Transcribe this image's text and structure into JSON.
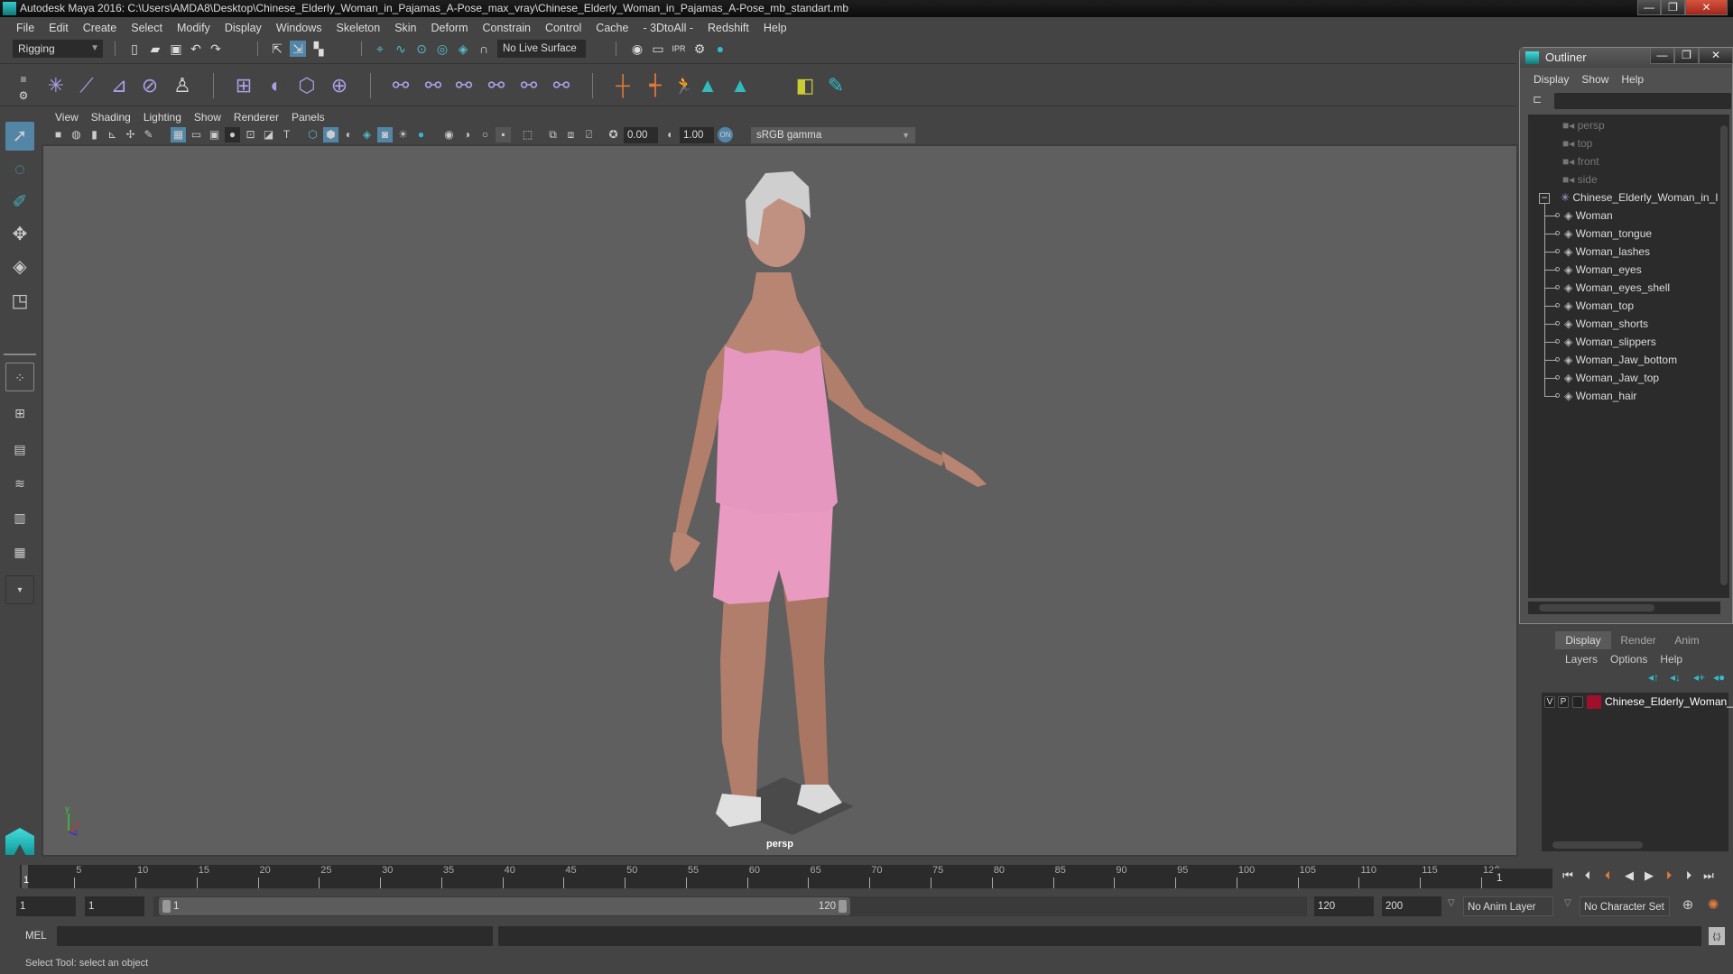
{
  "window": {
    "title": "Autodesk Maya 2016: C:\\Users\\AMDA8\\Desktop\\Chinese_Elderly_Woman_in_Pajamas_A-Pose_max_vray\\Chinese_Elderly_Woman_in_Pajamas_A-Pose_mb_standart.mb",
    "minimize": "—",
    "maximize": "❐",
    "close": "✕"
  },
  "menubar": [
    "File",
    "Edit",
    "Create",
    "Select",
    "Modify",
    "Display",
    "Windows",
    "Skeleton",
    "Skin",
    "Deform",
    "Constrain",
    "Control",
    "Cache",
    "- 3DtoAll -",
    "Redshift",
    "Help"
  ],
  "statusline": {
    "menuset": "Rigging",
    "live_surface": "No Live Surface"
  },
  "panel": {
    "menu": [
      "View",
      "Shading",
      "Lighting",
      "Show",
      "Renderer",
      "Panels"
    ],
    "exposure": "0.00",
    "gamma": "1.00",
    "color_space": "sRGB gamma",
    "camera_label": "persp"
  },
  "timeline": {
    "start": 1,
    "end": 120,
    "ticks": [
      5,
      10,
      15,
      20,
      25,
      30,
      35,
      40,
      45,
      50,
      55,
      60,
      65,
      70,
      75,
      80,
      85,
      90,
      95,
      100,
      105,
      110,
      115,
      120
    ],
    "current_frame_label": "1",
    "current_frame_field": "1"
  },
  "range": {
    "anim_start": "1",
    "playback_start": "1",
    "slider_start_label": "1",
    "slider_end_label": "120",
    "playback_end": "120",
    "anim_end": "200",
    "anim_layer": "No Anim Layer",
    "character_set": "No Character Set"
  },
  "cmdline": {
    "label": "MEL"
  },
  "helpline": {
    "text": "Select Tool: select an object"
  },
  "outliner": {
    "title": "Outliner",
    "menu": [
      "Display",
      "Show",
      "Help"
    ],
    "cameras": [
      "persp",
      "top",
      "front",
      "side"
    ],
    "group": "Chinese_Elderly_Woman_in_I",
    "children": [
      "Woman",
      "Woman_tongue",
      "Woman_lashes",
      "Woman_eyes",
      "Woman_eyes_shell",
      "Woman_top",
      "Woman_shorts",
      "Woman_slippers",
      "Woman_Jaw_bottom",
      "Woman_Jaw_top",
      "Woman_hair"
    ]
  },
  "layers": {
    "tabs": [
      "Display",
      "Render",
      "Anim"
    ],
    "active_tab": "Display",
    "menu": [
      "Layers",
      "Options",
      "Help"
    ],
    "items": [
      {
        "v": "V",
        "p": "P",
        "color": "#a0102a",
        "name": "Chinese_Elderly_Woman_ir"
      }
    ]
  },
  "colors": {
    "accent": "#5285a6",
    "viewport_bg": "#5f5f5f",
    "panel_bg": "#444444",
    "field_bg": "#2b2b2b",
    "layer_color": "#a0102a"
  }
}
